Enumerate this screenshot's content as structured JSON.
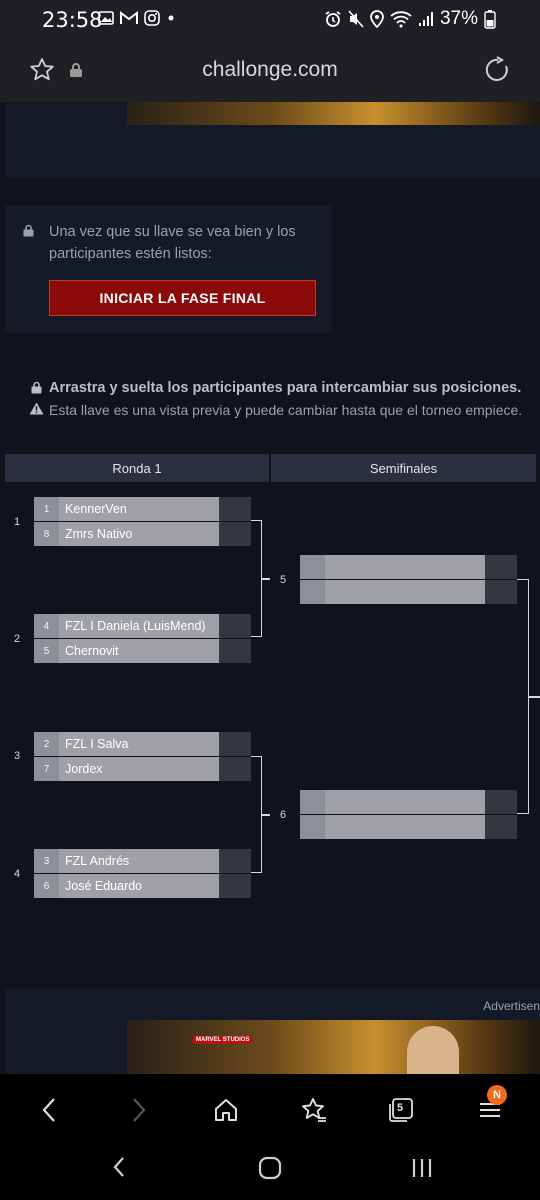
{
  "status_bar": {
    "time": "23:58",
    "battery": "37%"
  },
  "browser": {
    "url": "challonge.com"
  },
  "start_panel": {
    "lock_text": "Una vez que su llave se vea bien y los participantes estén listos:",
    "start_button": "INICIAR LA FASE FINAL"
  },
  "notices": {
    "drag_text": "Arrastra y suelta los participantes para intercambiar sus posiciones.",
    "preview_text": "Esta llave es una vista previa y puede cambiar hasta que el torneo empiece."
  },
  "bracket": {
    "rounds": [
      "Ronda 1",
      "Semifinales"
    ],
    "round1": [
      {
        "id": "1",
        "top": {
          "seed": "1",
          "name": "KennerVen"
        },
        "bottom": {
          "seed": "8",
          "name": "Zmrs Nativo"
        }
      },
      {
        "id": "2",
        "top": {
          "seed": "4",
          "name": "FZL I Daniela (LuisMend)"
        },
        "bottom": {
          "seed": "5",
          "name": "Chernovit"
        }
      },
      {
        "id": "3",
        "top": {
          "seed": "2",
          "name": "FZL I Salva"
        },
        "bottom": {
          "seed": "7",
          "name": "Jordex"
        }
      },
      {
        "id": "4",
        "top": {
          "seed": "3",
          "name": "FZL Andrés"
        },
        "bottom": {
          "seed": "6",
          "name": "José Eduardo"
        }
      }
    ],
    "semifinals": [
      {
        "id": "5"
      },
      {
        "id": "6"
      }
    ]
  },
  "ad": {
    "label": "Advertisen",
    "brand": "MARVEL STUDIOS"
  },
  "browser_nav": {
    "tabs_count": "5",
    "menu_badge": "N"
  },
  "colors": {
    "cta": "#8b0a0a",
    "page_bg": "#10131c",
    "badge": "#f26b1d"
  }
}
